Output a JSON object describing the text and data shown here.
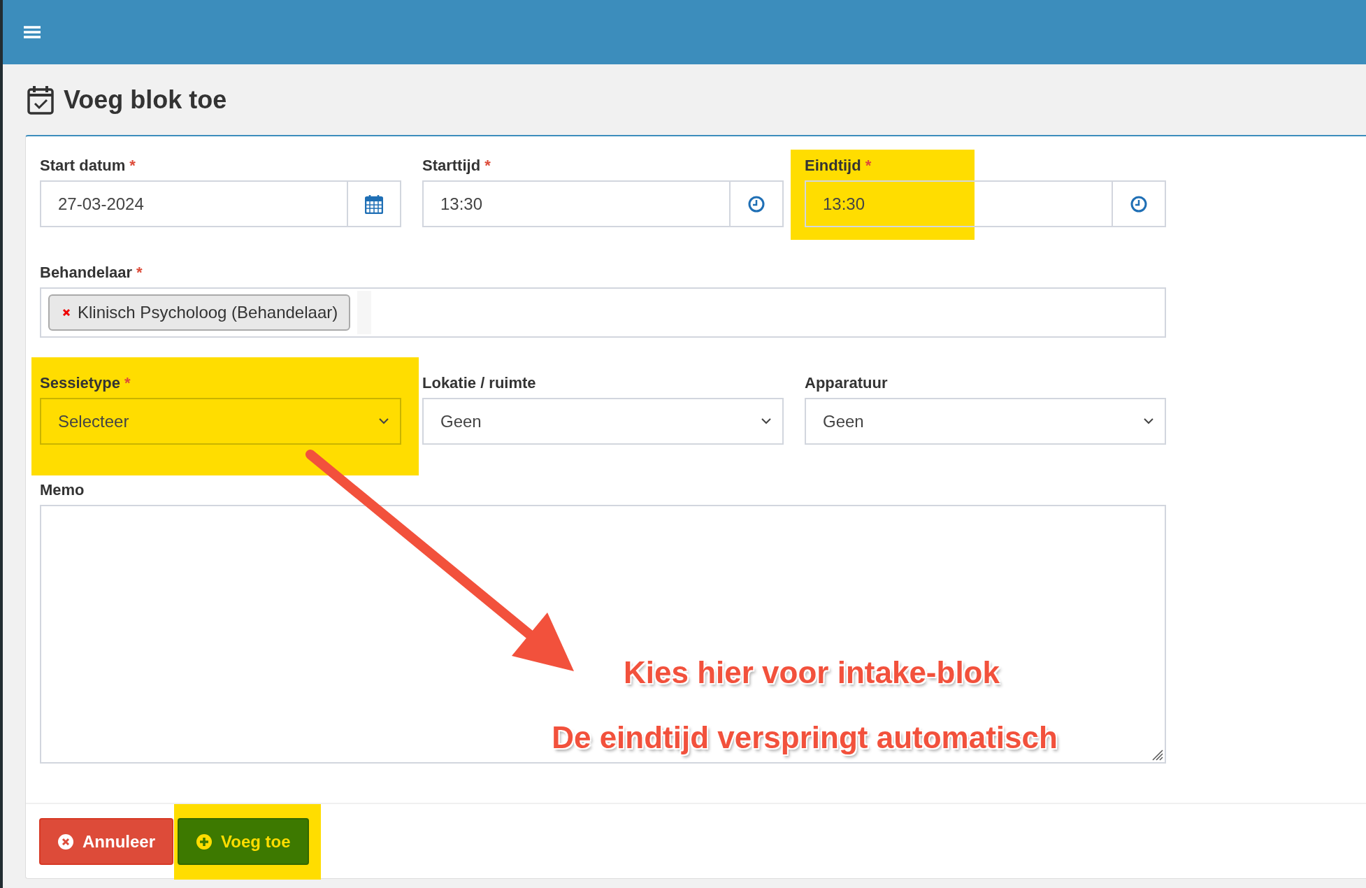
{
  "page_title": "Voeg blok toe",
  "fields": [
    {
      "kind": "date",
      "label": "Start datum",
      "required_mark": "*",
      "value": "27-03-2024",
      "highlighted": false
    },
    {
      "kind": "time",
      "label": "Starttijd",
      "required_mark": "*",
      "value": "13:30",
      "highlighted": false
    },
    {
      "kind": "time",
      "label": "Eindtijd",
      "required_mark": "*",
      "value": "13:30",
      "highlighted": true
    },
    {
      "kind": "tags",
      "label": "Behandelaar",
      "required_mark": "*",
      "tags": [
        "Klinisch Psycholoog (Behandelaar)"
      ],
      "highlighted": false
    },
    {
      "kind": "select",
      "label": "Sessietype",
      "required_mark": "*",
      "value": "Selecteer",
      "highlighted": true
    },
    {
      "kind": "select",
      "label": "Lokatie / ruimte",
      "value": "Geen",
      "highlighted": false
    },
    {
      "kind": "select",
      "label": "Apparatuur",
      "value": "Geen",
      "highlighted": false
    },
    {
      "kind": "textarea",
      "label": "Memo",
      "highlighted": false
    }
  ],
  "buttons": [
    {
      "kind": "cancel",
      "label": "Annuleer",
      "highlighted": false
    },
    {
      "kind": "add",
      "label": "Voeg toe",
      "highlighted": true
    }
  ],
  "annotations": [
    "Kies hier voor intake-blok",
    "De eindtijd verspringt automatisch"
  ]
}
